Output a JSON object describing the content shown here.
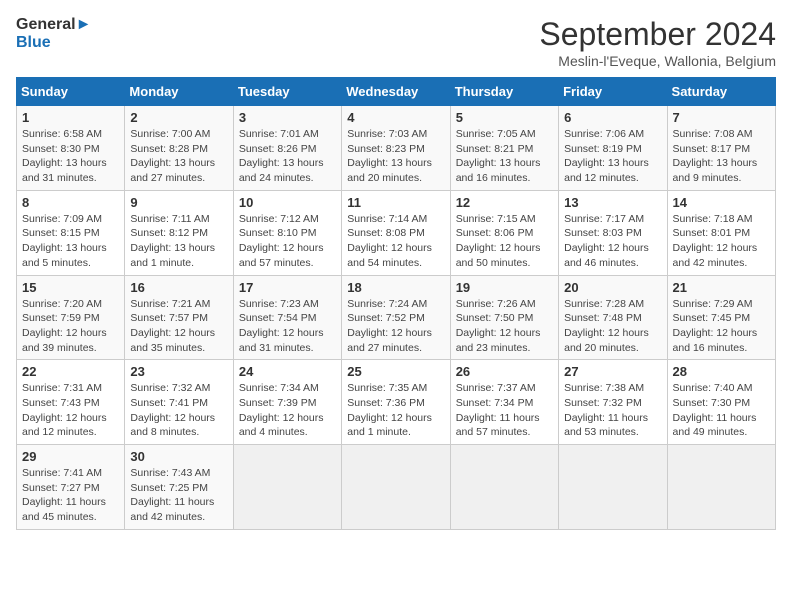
{
  "logo": {
    "line1": "General",
    "line2": "Blue"
  },
  "title": "September 2024",
  "subtitle": "Meslin-l'Eveque, Wallonia, Belgium",
  "days_header": [
    "Sunday",
    "Monday",
    "Tuesday",
    "Wednesday",
    "Thursday",
    "Friday",
    "Saturday"
  ],
  "weeks": [
    [
      {
        "day": "1",
        "info": "Sunrise: 6:58 AM\nSunset: 8:30 PM\nDaylight: 13 hours\nand 31 minutes."
      },
      {
        "day": "2",
        "info": "Sunrise: 7:00 AM\nSunset: 8:28 PM\nDaylight: 13 hours\nand 27 minutes."
      },
      {
        "day": "3",
        "info": "Sunrise: 7:01 AM\nSunset: 8:26 PM\nDaylight: 13 hours\nand 24 minutes."
      },
      {
        "day": "4",
        "info": "Sunrise: 7:03 AM\nSunset: 8:23 PM\nDaylight: 13 hours\nand 20 minutes."
      },
      {
        "day": "5",
        "info": "Sunrise: 7:05 AM\nSunset: 8:21 PM\nDaylight: 13 hours\nand 16 minutes."
      },
      {
        "day": "6",
        "info": "Sunrise: 7:06 AM\nSunset: 8:19 PM\nDaylight: 13 hours\nand 12 minutes."
      },
      {
        "day": "7",
        "info": "Sunrise: 7:08 AM\nSunset: 8:17 PM\nDaylight: 13 hours\nand 9 minutes."
      }
    ],
    [
      {
        "day": "8",
        "info": "Sunrise: 7:09 AM\nSunset: 8:15 PM\nDaylight: 13 hours\nand 5 minutes."
      },
      {
        "day": "9",
        "info": "Sunrise: 7:11 AM\nSunset: 8:12 PM\nDaylight: 13 hours\nand 1 minute."
      },
      {
        "day": "10",
        "info": "Sunrise: 7:12 AM\nSunset: 8:10 PM\nDaylight: 12 hours\nand 57 minutes."
      },
      {
        "day": "11",
        "info": "Sunrise: 7:14 AM\nSunset: 8:08 PM\nDaylight: 12 hours\nand 54 minutes."
      },
      {
        "day": "12",
        "info": "Sunrise: 7:15 AM\nSunset: 8:06 PM\nDaylight: 12 hours\nand 50 minutes."
      },
      {
        "day": "13",
        "info": "Sunrise: 7:17 AM\nSunset: 8:03 PM\nDaylight: 12 hours\nand 46 minutes."
      },
      {
        "day": "14",
        "info": "Sunrise: 7:18 AM\nSunset: 8:01 PM\nDaylight: 12 hours\nand 42 minutes."
      }
    ],
    [
      {
        "day": "15",
        "info": "Sunrise: 7:20 AM\nSunset: 7:59 PM\nDaylight: 12 hours\nand 39 minutes."
      },
      {
        "day": "16",
        "info": "Sunrise: 7:21 AM\nSunset: 7:57 PM\nDaylight: 12 hours\nand 35 minutes."
      },
      {
        "day": "17",
        "info": "Sunrise: 7:23 AM\nSunset: 7:54 PM\nDaylight: 12 hours\nand 31 minutes."
      },
      {
        "day": "18",
        "info": "Sunrise: 7:24 AM\nSunset: 7:52 PM\nDaylight: 12 hours\nand 27 minutes."
      },
      {
        "day": "19",
        "info": "Sunrise: 7:26 AM\nSunset: 7:50 PM\nDaylight: 12 hours\nand 23 minutes."
      },
      {
        "day": "20",
        "info": "Sunrise: 7:28 AM\nSunset: 7:48 PM\nDaylight: 12 hours\nand 20 minutes."
      },
      {
        "day": "21",
        "info": "Sunrise: 7:29 AM\nSunset: 7:45 PM\nDaylight: 12 hours\nand 16 minutes."
      }
    ],
    [
      {
        "day": "22",
        "info": "Sunrise: 7:31 AM\nSunset: 7:43 PM\nDaylight: 12 hours\nand 12 minutes."
      },
      {
        "day": "23",
        "info": "Sunrise: 7:32 AM\nSunset: 7:41 PM\nDaylight: 12 hours\nand 8 minutes."
      },
      {
        "day": "24",
        "info": "Sunrise: 7:34 AM\nSunset: 7:39 PM\nDaylight: 12 hours\nand 4 minutes."
      },
      {
        "day": "25",
        "info": "Sunrise: 7:35 AM\nSunset: 7:36 PM\nDaylight: 12 hours\nand 1 minute."
      },
      {
        "day": "26",
        "info": "Sunrise: 7:37 AM\nSunset: 7:34 PM\nDaylight: 11 hours\nand 57 minutes."
      },
      {
        "day": "27",
        "info": "Sunrise: 7:38 AM\nSunset: 7:32 PM\nDaylight: 11 hours\nand 53 minutes."
      },
      {
        "day": "28",
        "info": "Sunrise: 7:40 AM\nSunset: 7:30 PM\nDaylight: 11 hours\nand 49 minutes."
      }
    ],
    [
      {
        "day": "29",
        "info": "Sunrise: 7:41 AM\nSunset: 7:27 PM\nDaylight: 11 hours\nand 45 minutes."
      },
      {
        "day": "30",
        "info": "Sunrise: 7:43 AM\nSunset: 7:25 PM\nDaylight: 11 hours\nand 42 minutes."
      },
      {
        "day": "",
        "info": ""
      },
      {
        "day": "",
        "info": ""
      },
      {
        "day": "",
        "info": ""
      },
      {
        "day": "",
        "info": ""
      },
      {
        "day": "",
        "info": ""
      }
    ]
  ]
}
